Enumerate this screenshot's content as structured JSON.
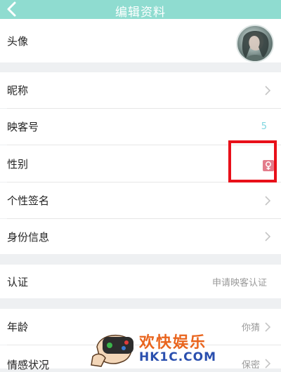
{
  "header": {
    "title": "编辑资料",
    "bg_color": "#8fdcd0"
  },
  "rows": {
    "avatar": {
      "label": "头像"
    },
    "nickname": {
      "label": "昵称"
    },
    "yingke_id": {
      "label": "映客号",
      "value": "5"
    },
    "gender": {
      "label": "性别",
      "icon": "female-icon"
    },
    "signature": {
      "label": "个性签名"
    },
    "identity": {
      "label": "身份信息"
    },
    "certification": {
      "label": "认证",
      "value": "申请映客认证"
    },
    "age": {
      "label": "年龄",
      "value": "你猜"
    },
    "relationship": {
      "label": "情感状况",
      "value": "保密"
    }
  },
  "watermark": {
    "text_cn": "欢快娱乐",
    "text_site": "HK1C.COM"
  }
}
